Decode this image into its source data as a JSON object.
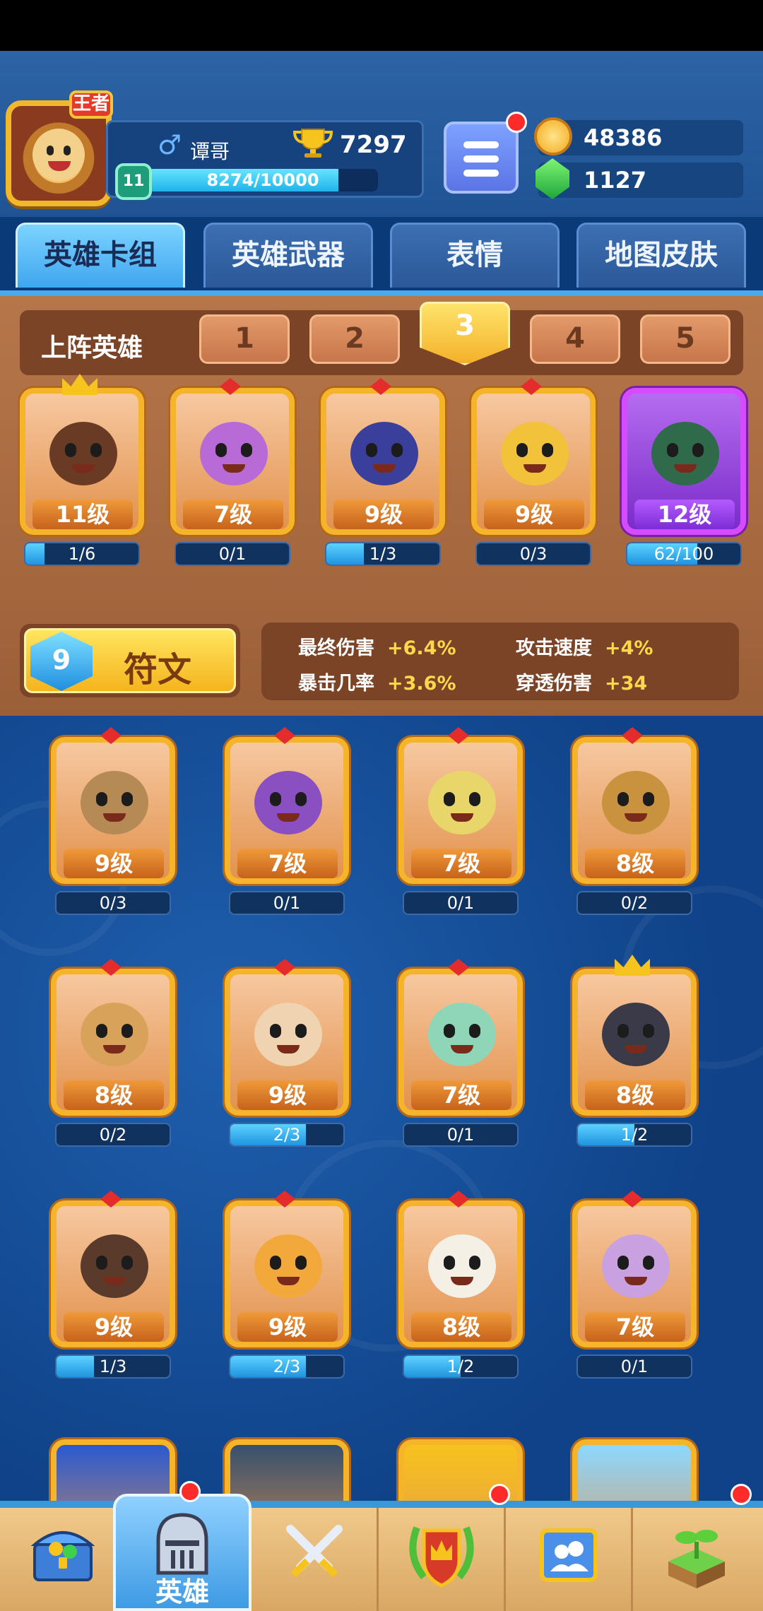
{
  "player": {
    "name": "谭哥",
    "rank_badge": "王者",
    "trophies": "7297",
    "level": "11",
    "xp_text": "8274/10000",
    "xp_fraction": 0.8274
  },
  "currencies": {
    "gold": "48386",
    "gems": "1127"
  },
  "tabs": [
    {
      "label": "英雄卡组",
      "active": true
    },
    {
      "label": "英雄武器",
      "active": false
    },
    {
      "label": "表情",
      "active": false
    },
    {
      "label": "地图皮肤",
      "active": false
    }
  ],
  "lineup": {
    "title": "上阵英雄",
    "slots": [
      "1",
      "2",
      "3",
      "4",
      "5"
    ],
    "active_slot": "3",
    "heroes": [
      {
        "level": "11级",
        "progress": "1/6",
        "fraction": 0.167,
        "theme": "crown",
        "color": "#6a3b24"
      },
      {
        "level": "7级",
        "progress": "0/1",
        "fraction": 0,
        "theme": "gem",
        "color": "#b86bd6"
      },
      {
        "level": "9级",
        "progress": "1/3",
        "fraction": 0.333,
        "theme": "gem",
        "color": "#3b3f9c"
      },
      {
        "level": "9级",
        "progress": "0/3",
        "fraction": 0,
        "theme": "gem",
        "color": "#f2c23a"
      },
      {
        "level": "12级",
        "progress": "62/100",
        "fraction": 0.62,
        "theme": "purple",
        "color": "#2f6b4a"
      }
    ]
  },
  "rune": {
    "icon_glyph": "9",
    "label": "符文"
  },
  "stats": [
    {
      "name": "最终伤害",
      "value": "+6.4%"
    },
    {
      "name": "攻击速度",
      "value": "+4%"
    },
    {
      "name": "暴击几率",
      "value": "+3.6%"
    },
    {
      "name": "穿透伤害",
      "value": "+34"
    }
  ],
  "collection": [
    {
      "level": "9级",
      "progress": "0/3",
      "fraction": 0,
      "theme": "gem",
      "color": "#b58a55"
    },
    {
      "level": "7级",
      "progress": "0/1",
      "fraction": 0,
      "theme": "gem",
      "color": "#8a4fc0"
    },
    {
      "level": "7级",
      "progress": "0/1",
      "fraction": 0,
      "theme": "gem",
      "color": "#e8d66a"
    },
    {
      "level": "8级",
      "progress": "0/2",
      "fraction": 0,
      "theme": "gem",
      "color": "#c9923f"
    },
    {
      "level": "8级",
      "progress": "0/2",
      "fraction": 0,
      "theme": "gem",
      "color": "#d9a25a"
    },
    {
      "level": "9级",
      "progress": "2/3",
      "fraction": 0.667,
      "theme": "gem",
      "color": "#f0d3b0"
    },
    {
      "level": "7级",
      "progress": "0/1",
      "fraction": 0,
      "theme": "gem",
      "color": "#8fd6b8"
    },
    {
      "level": "8级",
      "progress": "1/2",
      "fraction": 0.5,
      "theme": "crown",
      "color": "#3a3a48"
    },
    {
      "level": "9级",
      "progress": "1/3",
      "fraction": 0.333,
      "theme": "gem",
      "color": "#5a3a2a"
    },
    {
      "level": "9级",
      "progress": "2/3",
      "fraction": 0.667,
      "theme": "gem",
      "color": "#f2a83a"
    },
    {
      "level": "8级",
      "progress": "1/2",
      "fraction": 0.5,
      "theme": "gem",
      "color": "#f4f0e6"
    },
    {
      "level": "7级",
      "progress": "0/1",
      "fraction": 0,
      "theme": "gem",
      "color": "#c9a0e0"
    }
  ],
  "partial_cards": [
    {
      "color": "#2a5ad0"
    },
    {
      "color": "#37506e"
    },
    {
      "color": "#f7c31e"
    },
    {
      "color": "#8cd8ff"
    }
  ],
  "bottom_nav": [
    {
      "icon": "treasure-chest-icon",
      "label": "",
      "active": false,
      "badge": false
    },
    {
      "icon": "knight-helmet-icon",
      "label": "英雄",
      "active": true,
      "badge": true
    },
    {
      "icon": "crossed-swords-icon",
      "label": "",
      "active": false,
      "badge": false
    },
    {
      "icon": "crown-shield-icon",
      "label": "",
      "active": false,
      "badge": true
    },
    {
      "icon": "team-board-icon",
      "label": "",
      "active": false,
      "badge": false
    },
    {
      "icon": "sprout-block-icon",
      "label": "",
      "active": false,
      "badge": true
    }
  ],
  "colors": {
    "gold_accent": "#f5b42a",
    "progress_blue": "#1e95e0",
    "board_brown": "#9b5f38",
    "background_blue": "#0f4288"
  }
}
